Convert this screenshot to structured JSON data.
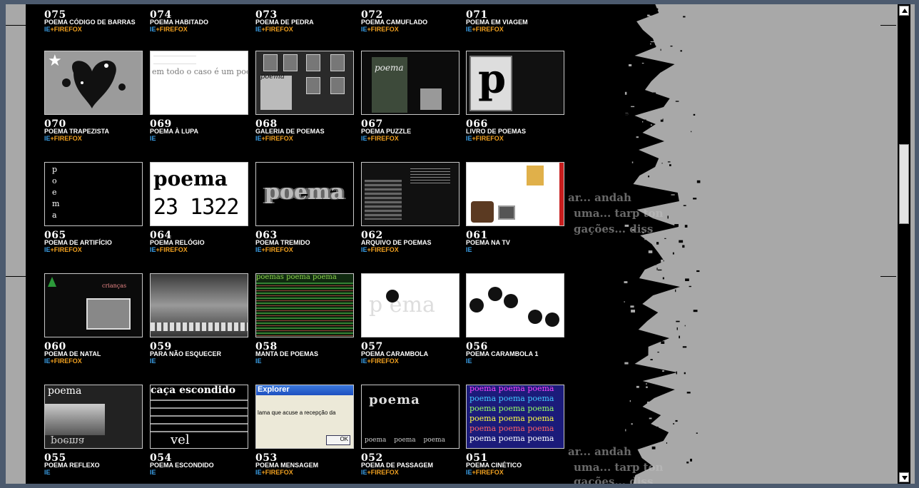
{
  "platforms": {
    "ie": "IE",
    "plus": "+",
    "firefox": "FIREFOX"
  },
  "rows": [
    {
      "items": [
        {
          "num": "075",
          "title": "POEMA CÓDIGO DE BARRAS",
          "ff": true,
          "thumb": "none"
        },
        {
          "num": "074",
          "title": "POEMA HABITADO",
          "ff": true,
          "thumb": "none"
        },
        {
          "num": "073",
          "title": "POEMA DE PEDRA",
          "ff": true,
          "thumb": "none"
        },
        {
          "num": "072",
          "title": "POEMA CAMUFLADO",
          "ff": true,
          "thumb": "none"
        },
        {
          "num": "071",
          "title": "POEMA EM VIAGEM",
          "ff": true,
          "thumb": "none"
        }
      ]
    },
    {
      "items": [
        {
          "num": "070",
          "title": "POEMA TRAPEZISTA",
          "ff": true,
          "thumb": "trapezista"
        },
        {
          "num": "069",
          "title": "POEMA À LUPA",
          "ff": false,
          "thumb": "lupa",
          "thumb_text": "em todo o caso é um poema"
        },
        {
          "num": "068",
          "title": "GALERIA DE POEMAS",
          "ff": true,
          "thumb": "galeria",
          "thumb_text": "poema"
        },
        {
          "num": "067",
          "title": "POEMA PUZZLE",
          "ff": true,
          "thumb": "puzzle",
          "thumb_text": "poema"
        },
        {
          "num": "066",
          "title": "LIVRO DE POEMAS",
          "ff": true,
          "thumb": "livro",
          "thumb_text": "p"
        }
      ]
    },
    {
      "items": [
        {
          "num": "065",
          "title": "POEMA DE ARTIFÍCIO",
          "ff": true,
          "thumb": "artificio",
          "thumb_text": "p o e m a"
        },
        {
          "num": "064",
          "title": "POEMA RELÓGIO",
          "ff": true,
          "thumb": "relogio",
          "thumb_text": "poema",
          "thumb_text2": "23 1322"
        },
        {
          "num": "063",
          "title": "POEMA TREMIDO",
          "ff": true,
          "thumb": "tremido",
          "thumb_text": "poema"
        },
        {
          "num": "062",
          "title": "ARQUIVO DE POEMAS",
          "ff": true,
          "thumb": "arquivo"
        },
        {
          "num": "061",
          "title": "POEMA NA TV",
          "ff": false,
          "thumb": "tv"
        }
      ]
    },
    {
      "items": [
        {
          "num": "060",
          "title": "POEMA DE NATAL",
          "ff": true,
          "thumb": "natal",
          "thumb_text": "crianças"
        },
        {
          "num": "059",
          "title": "PARA NÃO ESQUECER",
          "ff": false,
          "thumb": "esquecer"
        },
        {
          "num": "058",
          "title": "MANTA DE POEMAS",
          "ff": false,
          "thumb": "manta",
          "thumb_text": "poemas poema poema"
        },
        {
          "num": "057",
          "title": "POEMA CARAMBOLA",
          "ff": true,
          "thumb": "carambola",
          "thumb_text": "p ema"
        },
        {
          "num": "056",
          "title": "POEMA CARAMBOLA 1",
          "ff": false,
          "thumb": "carambola1"
        }
      ]
    },
    {
      "items": [
        {
          "num": "055",
          "title": "POEMA REFLEXO",
          "ff": false,
          "thumb": "reflexo",
          "thumb_text": "poema"
        },
        {
          "num": "054",
          "title": "POEMA ESCONDIDO",
          "ff": false,
          "thumb": "escondido",
          "thumb_text": "caça escondido",
          "thumb_text2": "vel"
        },
        {
          "num": "053",
          "title": "POEMA MENSAGEM",
          "ff": true,
          "thumb": "mensagem",
          "thumb_text": "Explorer",
          "thumb_text2": "lama que acuse a recepção da",
          "thumb_text3": "OK"
        },
        {
          "num": "052",
          "title": "POEMA DE PASSAGEM",
          "ff": true,
          "thumb": "passagem",
          "thumb_text": "poema",
          "thumb_text2": "poema poema poema"
        },
        {
          "num": "051",
          "title": "POEMA CINÉTICO",
          "ff": true,
          "thumb": "cinetico",
          "thumb_text": "poema poema poema"
        }
      ]
    }
  ],
  "ghost_text": [
    "ar... andah",
    "uma... tarp ton",
    "gações... diss"
  ],
  "colors": {
    "ie": "#3a9ee6",
    "firefox": "#f0a020",
    "page_bg": "#000000",
    "frame_bg": "#a8a8a8",
    "window_border": "#4c5a6e"
  }
}
